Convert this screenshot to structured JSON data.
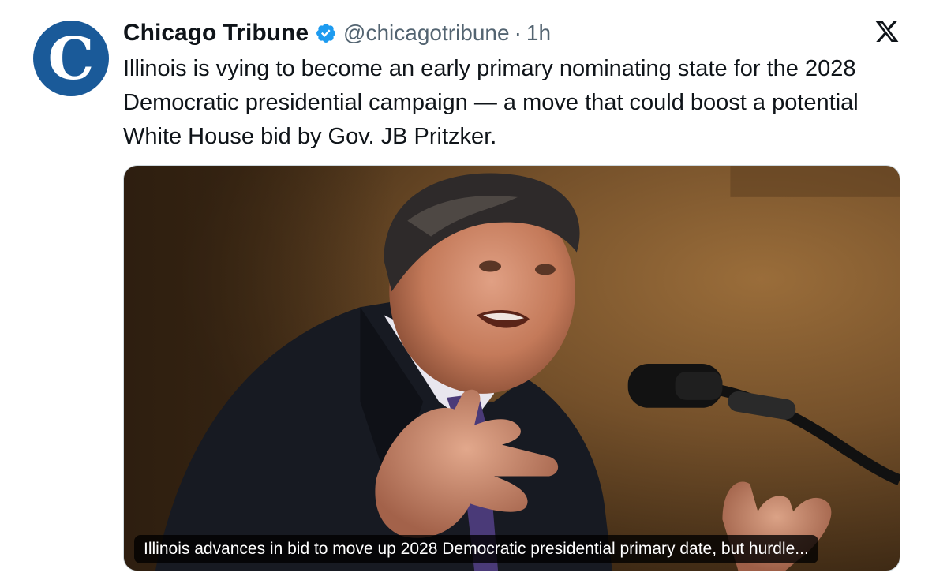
{
  "tweet": {
    "author": {
      "display_name": "Chicago Tribune",
      "handle": "@chicagotribune",
      "avatar_letter": "C",
      "avatar_color": "#1a5a99",
      "verified": true,
      "verified_icon": "verified-badge-icon",
      "verified_color": "#1d9bf0"
    },
    "separator": "·",
    "time": "1h",
    "platform_icon": "x-logo-icon",
    "text": "Illinois is vying to become an early primary nominating state for the 2028 Democratic presidential campaign — a move that could boost a potential White House bid by Gov. JB Pritzker.",
    "card": {
      "caption": "Illinois advances in bid to move up 2028 Democratic presidential primary date, but hurdle..."
    }
  },
  "colors": {
    "text_primary": "#0f1419",
    "text_secondary": "#536471",
    "background": "#ffffff"
  }
}
